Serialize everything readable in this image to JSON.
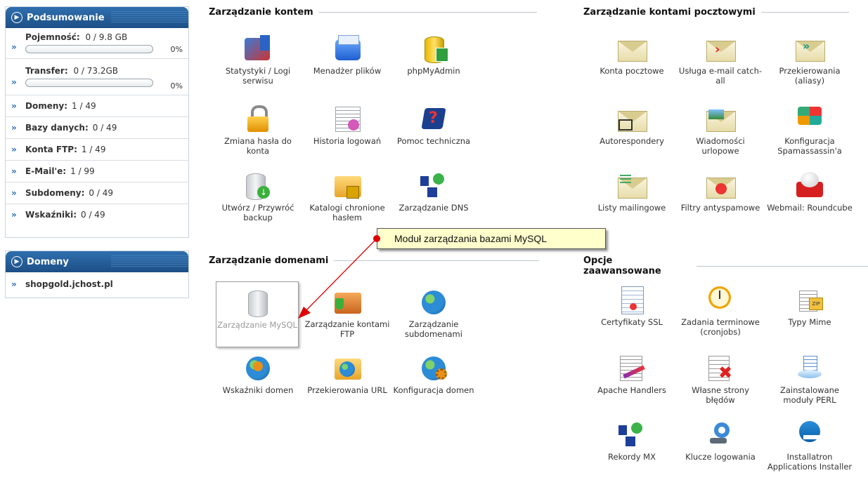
{
  "summary": {
    "title": "Podsumowanie",
    "capacity": {
      "label": "Pojemność:",
      "value": "0 / 9.8 GB",
      "percent": "0%"
    },
    "transfer": {
      "label": "Transfer:",
      "value": "0 / 73.2GB",
      "percent": "0%"
    },
    "rows": [
      {
        "label": "Domeny:",
        "value": "1 / 49"
      },
      {
        "label": "Bazy danych:",
        "value": "0 / 49"
      },
      {
        "label": "Konta FTP:",
        "value": "1 / 49"
      },
      {
        "label": "E-Mail'e:",
        "value": "1 / 99"
      },
      {
        "label": "Subdomeny:",
        "value": "0 / 49"
      },
      {
        "label": "Wskaźniki:",
        "value": "0 / 49"
      }
    ]
  },
  "domains": {
    "title": "Domeny",
    "items": [
      "shopgold.jchost.pl"
    ]
  },
  "sections": {
    "account": {
      "title": "Zarządzanie kontem",
      "items": [
        "Statystyki / Logi serwisu",
        "Menadżer plików",
        "phpMyAdmin",
        "Zmiana hasła do konta",
        "Historia logowań",
        "Pomoc techniczna",
        "Utwórz / Przywróć backup",
        "Katalogi chronione hasłem",
        "Zarządzanie DNS"
      ]
    },
    "mail": {
      "title": "Zarządzanie kontami pocztowymi",
      "items": [
        "Konta pocztowe",
        "Usługa e-mail catch-all",
        "Przekierowania (aliasy)",
        "Autorespondery",
        "Wiadomości urlopowe",
        "Konfiguracja Spamassassin'a",
        "Listy mailingowe",
        "Filtry antyspamowe",
        "Webmail: Roundcube"
      ]
    },
    "domains": {
      "title": "Zarządzanie domenami",
      "items": [
        "Zarządzanie MySQL",
        "Zarządzanie kontami FTP",
        "Zarządzanie subdomenami",
        "Wskaźniki domen",
        "Przekierowania URL",
        "Konfiguracja domen"
      ]
    },
    "advanced": {
      "title": "Opcje zaawansowane",
      "items": [
        "Certyfikaty SSL",
        "Zadania terminowe (cronjobs)",
        "Typy Mime",
        "Apache Handlers",
        "Własne strony błędów",
        "Zainstalowane moduły PERL",
        "Rekordy MX",
        "Klucze logowania",
        "Installatron Applications Installer"
      ]
    }
  },
  "tooltip": "Moduł zarządzania bazami MySQL",
  "colors": {
    "panel_header": "#1d4f86",
    "tooltip_bg": "#ffffcc",
    "arrow": "#e00000"
  }
}
